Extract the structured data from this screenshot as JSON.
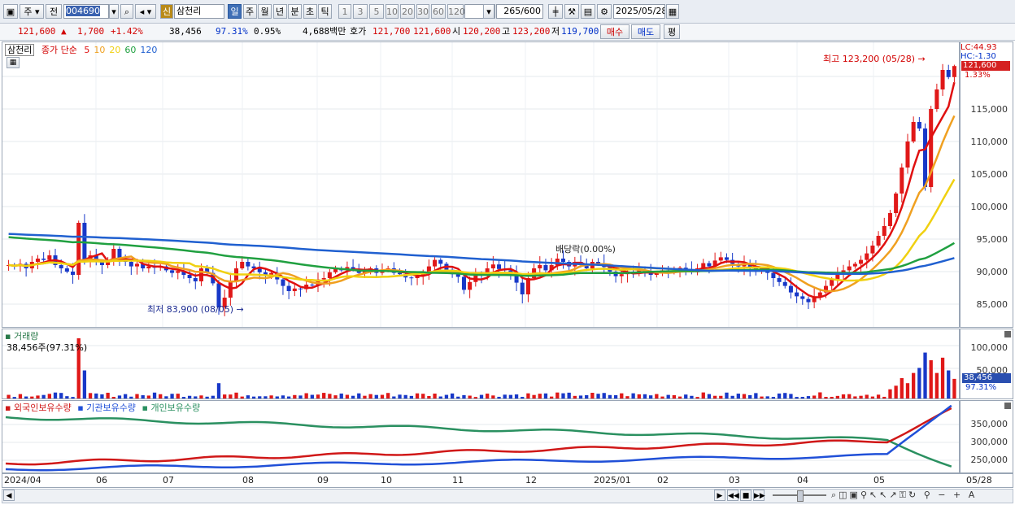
{
  "toolbar": {
    "market": "주",
    "prev": "전",
    "code": "004690",
    "new_badge": "신",
    "stock_name": "삼천리",
    "periods": [
      "일",
      "주",
      "월",
      "년",
      "분",
      "초",
      "틱"
    ],
    "active_period": "일",
    "intervals": [
      "1",
      "3",
      "5",
      "10",
      "20",
      "30",
      "60",
      "120"
    ],
    "count": "265",
    "count_total": "/600",
    "date": "2025/05/28"
  },
  "quote": {
    "price": "121,600",
    "change": "1,700",
    "change_pct": "+1.42%",
    "volume": "38,456",
    "vol_ratio": "97.31%",
    "turnover_pct": "0.95%",
    "amount": "4,688백만",
    "ask_label": "호가",
    "ask": "121,700",
    "bid": "121,600",
    "open_label": "시",
    "open": "120,200",
    "high_label": "고",
    "high": "123,200",
    "low_label": "저",
    "low": "119,700",
    "buy_button": "매수",
    "sell_button": "매도",
    "eval_button": "평"
  },
  "price_panel": {
    "legend_name": "삼천리",
    "legend_ma_label": "종가 단순",
    "ma_periods": [
      "5",
      "10",
      "20",
      "60",
      "120"
    ],
    "ma_colors": [
      "#e01010",
      "#f0a020",
      "#f0d010",
      "#20a040",
      "#2060d0"
    ],
    "right_top_1": "LC:44.93",
    "right_top_2": "HC:-1.30",
    "last_tag": "121,600",
    "last_pct": "1.33%",
    "yticks": [
      "115,000",
      "110,000",
      "105,000",
      "100,000",
      "95,000",
      "90,000",
      "85,000"
    ],
    "high_annotation": "최고 123,200 (05/28)",
    "low_annotation": "최저 83,900 (08/05)",
    "dividend_annotation": "배당락(0.00%)"
  },
  "volume_panel": {
    "title": "거래량",
    "info": "38,456주(97.31%)",
    "yticks": [
      "100,000",
      "50,000"
    ],
    "last_tag": "38,456",
    "last_pct": "97.31%"
  },
  "holdings_panel": {
    "legend": [
      "외국인보유수량",
      "기관보유수량",
      "개인보유수량"
    ],
    "colors": [
      "#d01818",
      "#2050d8",
      "#2a9060"
    ],
    "yticks": [
      "350,000",
      "300,000",
      "250,000"
    ]
  },
  "x_axis": {
    "labels": [
      "2024/04",
      "06",
      "07",
      "08",
      "09",
      "10",
      "11",
      "12",
      "2025/01",
      "02",
      "03",
      "04",
      "05"
    ],
    "last_date": "05/28"
  },
  "chart_data": {
    "type": "candlestick",
    "ylim": [
      82000,
      124000
    ],
    "close": [
      91000,
      90800,
      91200,
      90500,
      91500,
      92000,
      91800,
      92500,
      91000,
      90500,
      90000,
      89500,
      97500,
      91500,
      92500,
      91500,
      91000,
      91500,
      93500,
      92000,
      91500,
      90800,
      91200,
      90500,
      90800,
      90600,
      90800,
      90200,
      89800,
      90100,
      89500,
      89000,
      88500,
      90500,
      89800,
      88200,
      84500,
      86000,
      88500,
      90500,
      91500,
      90800,
      90500,
      89900,
      89500,
      89800,
      88800,
      87800,
      87000,
      87400,
      87300,
      88000,
      87900,
      88800,
      89000,
      89900,
      90500,
      90200,
      90700,
      90400,
      89800,
      90200,
      90500,
      89800,
      90100,
      90500,
      89800,
      89600,
      89100,
      89000,
      89300,
      89700,
      90800,
      91800,
      91200,
      90300,
      89600,
      89200,
      87200,
      88400,
      89700,
      89500,
      90500,
      91100,
      90400,
      90200,
      89800,
      88300,
      86500,
      89000,
      90500,
      91000,
      90200,
      91000,
      92000,
      91500,
      90800,
      91500,
      91000,
      90500,
      91500,
      91300,
      90700,
      90000,
      89300,
      89600,
      90000,
      89700,
      90200,
      89900,
      89500,
      89800,
      90200,
      89800,
      90200,
      90600,
      90300,
      89900,
      90500,
      91300,
      90800,
      91700,
      92200,
      91800,
      91200,
      90800,
      91200,
      90600,
      90100,
      90500,
      89800,
      89000,
      88400,
      87800,
      86800,
      86200,
      85800,
      85300,
      86200,
      86800,
      87800,
      88800,
      89500,
      90200,
      90800,
      91200,
      91800,
      92800,
      94000,
      95500,
      97000,
      99000,
      102000,
      106000,
      110000,
      113000,
      112000,
      103000,
      115000,
      118000,
      121000,
      119900,
      121600
    ],
    "ma_labels": [
      "5",
      "10",
      "20",
      "60",
      "120"
    ],
    "series_note": "values shown as candles with five moving averages",
    "high": 123200,
    "high_date": "05/28",
    "low": 83900,
    "low_date": "08/05"
  }
}
